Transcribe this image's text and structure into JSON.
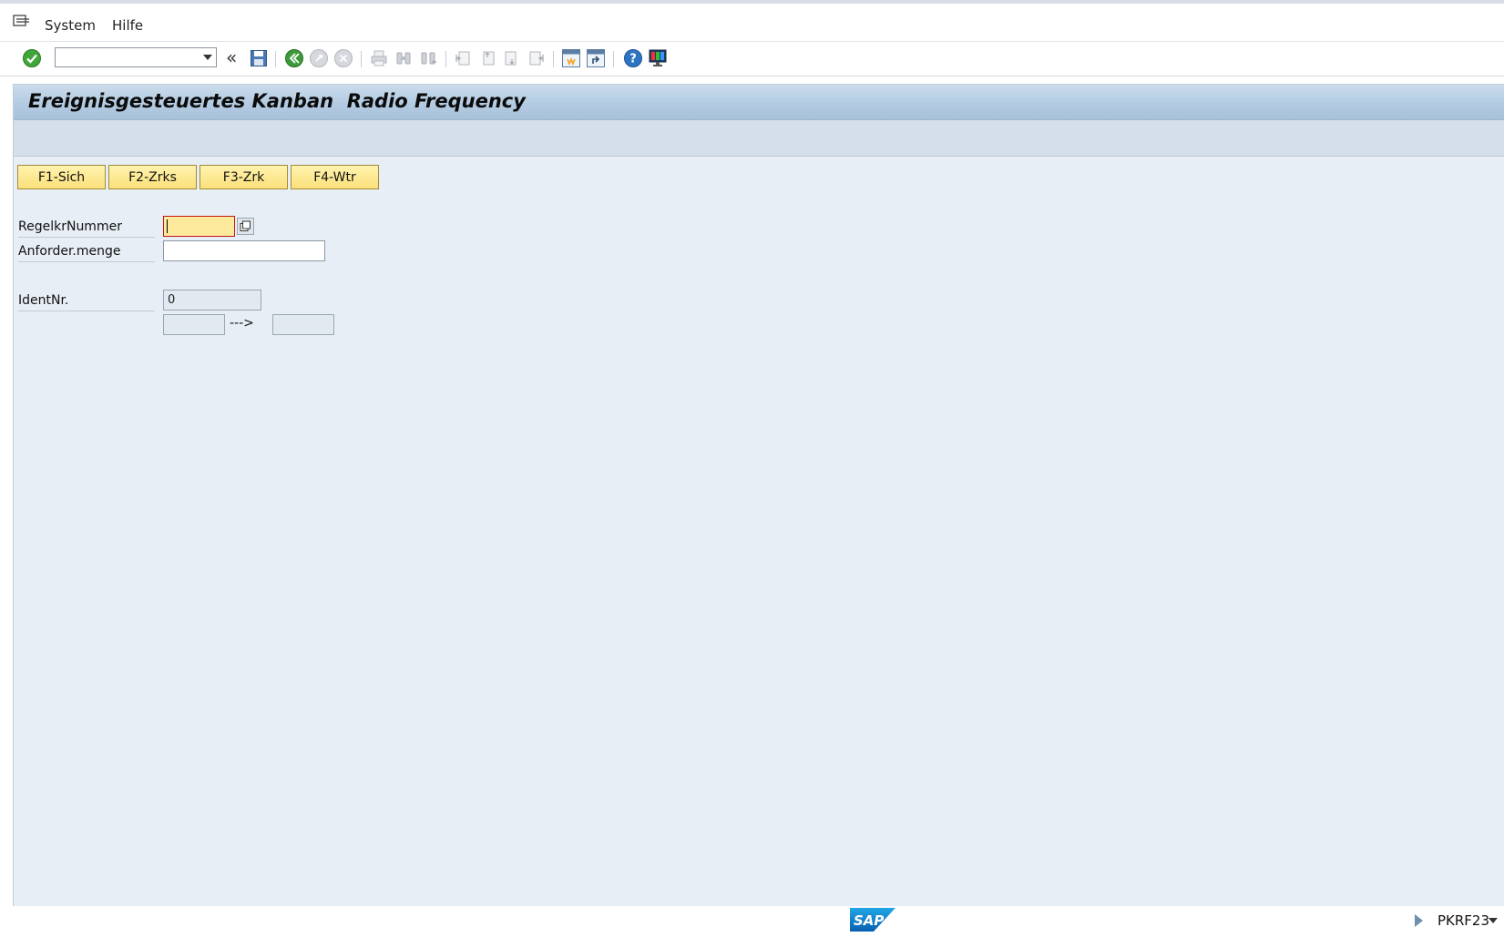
{
  "menu": {
    "items": [
      {
        "label": "System"
      },
      {
        "label": "Hilfe"
      }
    ]
  },
  "toolbar": {
    "command_field_value": "",
    "icons": [
      "enter-icon",
      "save-icon",
      "back-icon",
      "exit-icon",
      "cancel-icon",
      "print-icon",
      "find-icon",
      "find-next-icon",
      "first-page-icon",
      "previous-page-icon",
      "next-page-icon",
      "last-page-icon",
      "new-session-icon",
      "shortcut-icon",
      "help-icon",
      "customize-layout-icon"
    ]
  },
  "screen": {
    "title": "Ereignisgesteuertes Kanban  Radio Frequency"
  },
  "function_keys": [
    {
      "label": "F1-Sich"
    },
    {
      "label": "F2-Zrks"
    },
    {
      "label": "F3-Zrk"
    },
    {
      "label": "F4-Wtr"
    }
  ],
  "form": {
    "regelkreis": {
      "label": "RegelkrNummer",
      "value": ""
    },
    "anforder": {
      "label": "Anforder.menge",
      "value": ""
    },
    "ident": {
      "label": "IdentNr.",
      "value": "0"
    },
    "range": {
      "from": "",
      "arrow": "--->",
      "to": ""
    }
  },
  "status": {
    "logo": "SAP",
    "transaction": "PKRF23"
  },
  "colors": {
    "work_bg": "#e8eef5",
    "title_bar": "#b3cbe2",
    "fkey_yellow": "#fbe07a",
    "focus_field": "#fde99c"
  }
}
